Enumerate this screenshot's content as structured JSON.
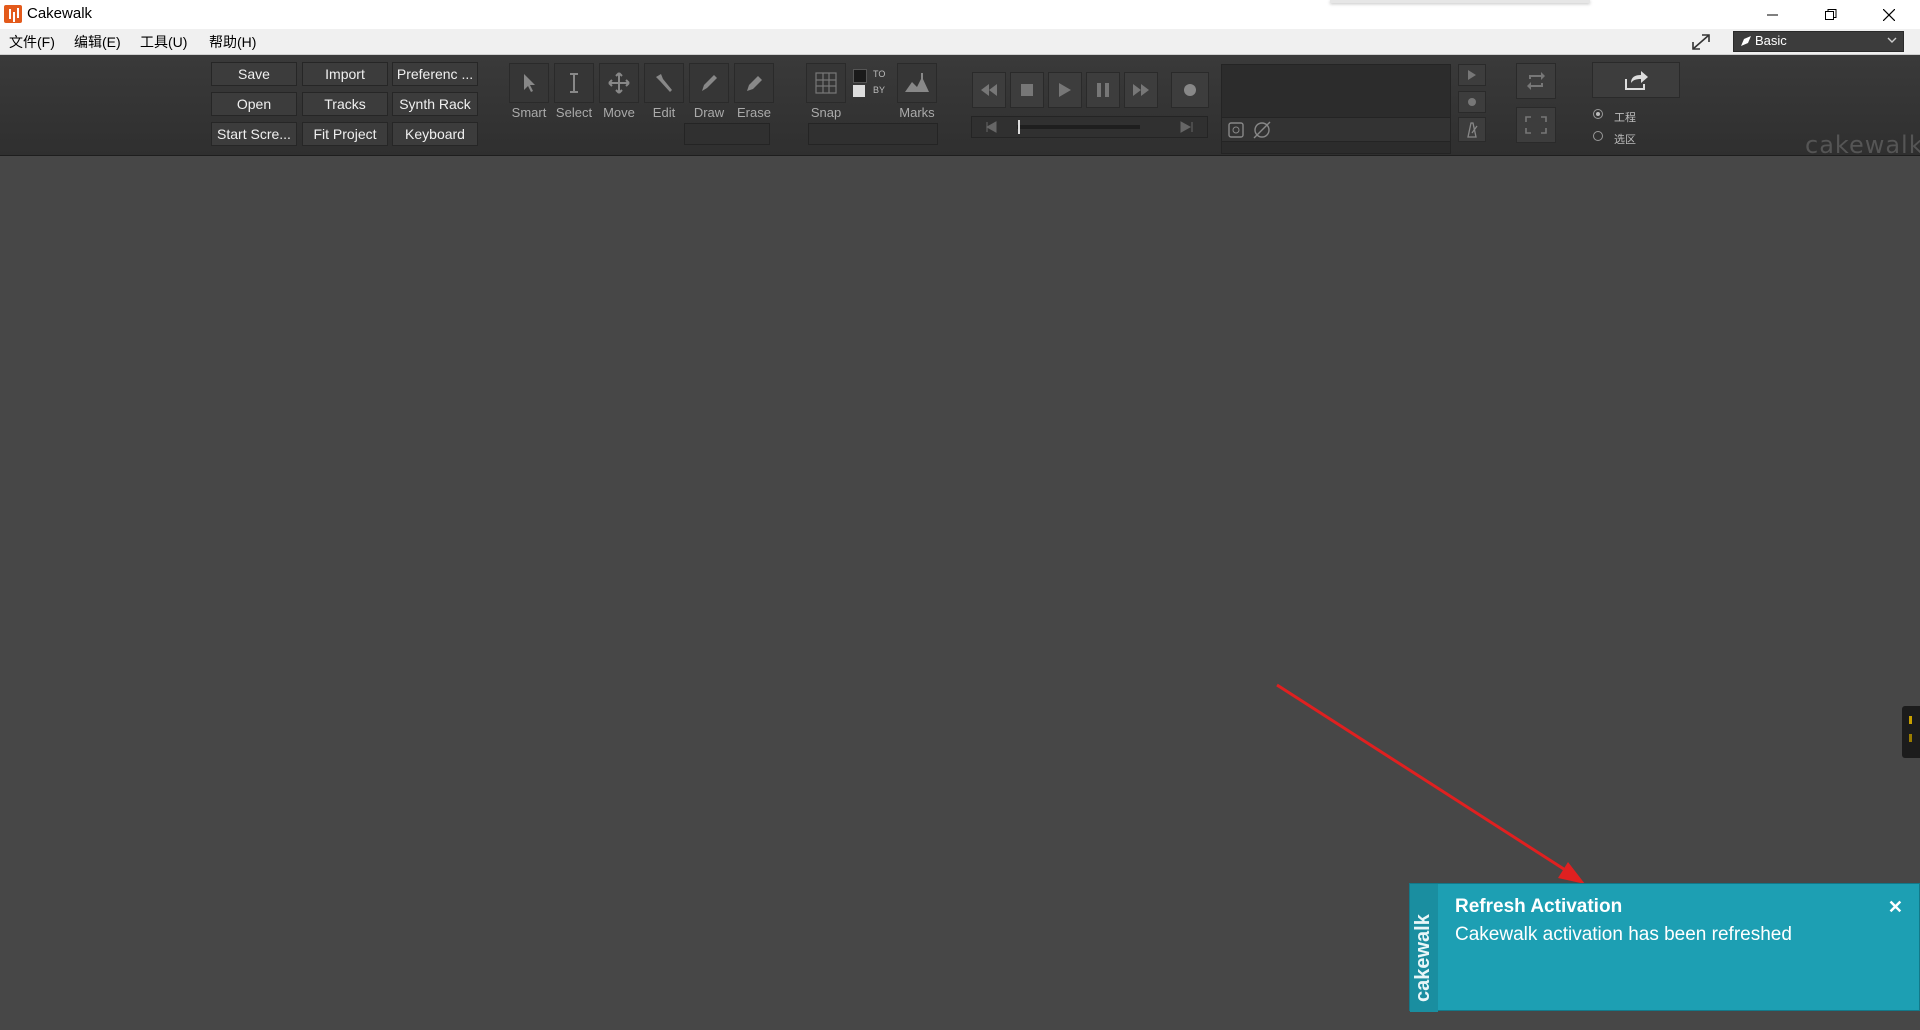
{
  "window": {
    "title": "Cakewalk"
  },
  "menu": {
    "items": [
      "文件(F)",
      "编辑(E)",
      "工具(U)",
      "帮助(H)"
    ]
  },
  "workspace": {
    "label": "Basic"
  },
  "quick_buttons": [
    [
      "Save",
      "Import",
      "Preferenc ..."
    ],
    [
      "Open",
      "Tracks",
      "Synth Rack"
    ],
    [
      "Start Scre...",
      "Fit Project",
      "Keyboard"
    ]
  ],
  "tools": [
    {
      "label": "Smart",
      "icon": "smart-arrow-icon"
    },
    {
      "label": "Select",
      "icon": "select-cursor-icon"
    },
    {
      "label": "Move",
      "icon": "move-cross-icon"
    },
    {
      "label": "Edit",
      "icon": "edit-tool-icon"
    },
    {
      "label": "Draw",
      "icon": "pencil-icon"
    },
    {
      "label": "Erase",
      "icon": "eraser-icon"
    }
  ],
  "snap": {
    "label": "Snap",
    "to": "TO",
    "by": "BY"
  },
  "marks": {
    "label": "Marks"
  },
  "export": {
    "option_project": "工程",
    "option_selection": "选区"
  },
  "notification": {
    "title": "Refresh Activation",
    "message": "Cakewalk activation has been refreshed",
    "brand": "cakewalk",
    "accent": "#1d9fb3"
  },
  "branding": {
    "logo_text": "cakewalk"
  },
  "colors": {
    "background": "#474747",
    "annotation_arrow": "#e02020"
  }
}
